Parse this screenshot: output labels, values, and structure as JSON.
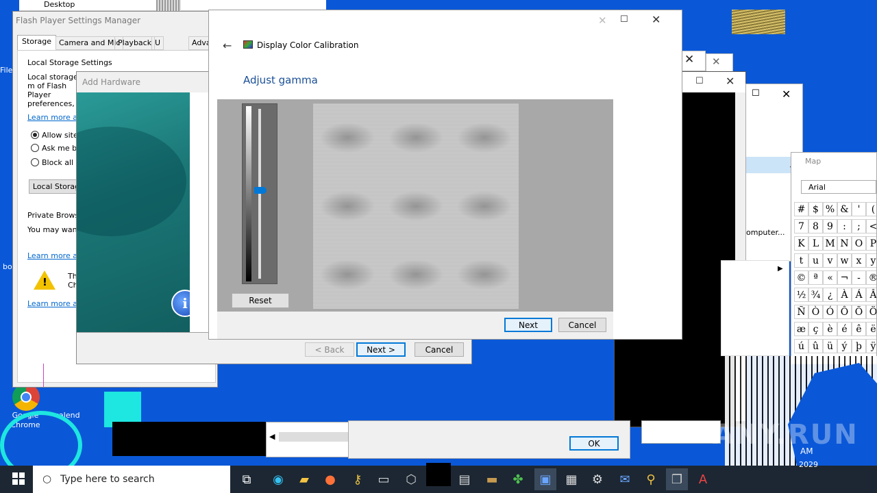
{
  "desktop": {
    "icons": [
      {
        "label": "Google Chrome"
      },
      {
        "label": "calend"
      },
      {
        "label": "bo"
      },
      {
        "label": "File"
      }
    ],
    "watermark": "ANY.RUN",
    "top_file_labels": [
      "Desktop"
    ]
  },
  "flash_window": {
    "title": "Flash Player Settings Manager",
    "tabs": [
      "Storage",
      "Camera and Mic",
      "Playback",
      "U",
      "Advance"
    ],
    "section_title": "Local Storage Settings",
    "description": "Local storage m of Flash Player preferences, o",
    "learn_more": "Learn more abo",
    "radios": [
      "Allow sites",
      "Ask me bef",
      "Block all sit"
    ],
    "local_storage_button": "Local Storag",
    "private_title": "Private Browsin",
    "private_text": "You may want",
    "learn_more_2": "Learn more abo",
    "warning_text": "Th Ch",
    "learn_more_3": "Learn more abo"
  },
  "add_hardware": {
    "title": "Add Hardware",
    "back_label": "< Back",
    "next_label": "Next >",
    "cancel_label": "Cancel"
  },
  "dcc": {
    "title": "Display Color Calibration",
    "heading": "Adjust gamma",
    "reset_label": "Reset",
    "next_label": "Next",
    "cancel_label": "Cancel",
    "slider_level": 0.52
  },
  "charmap": {
    "title": "Map",
    "font": "Arial",
    "side_text": "omputer...",
    "rows": [
      [
        "#",
        "$",
        "%",
        "&",
        "'",
        "("
      ],
      [
        "7",
        "8",
        "9",
        ":",
        ";",
        "<"
      ],
      [
        "K",
        "L",
        "M",
        "N",
        "O",
        "P"
      ],
      [
        "t",
        "u",
        "v",
        "w",
        "x",
        "y"
      ],
      [
        "©",
        "ª",
        "«",
        "¬",
        "-",
        "®"
      ],
      [
        "½",
        "¾",
        "¿",
        "À",
        "Á",
        "Â"
      ],
      [
        "Ñ",
        "Ò",
        "Ó",
        "Ô",
        "Õ",
        "Ö"
      ],
      [
        "æ",
        "ç",
        "è",
        "é",
        "ê",
        "ë"
      ],
      [
        "ú",
        "û",
        "ü",
        "ý",
        "þ",
        "ÿ"
      ]
    ]
  },
  "ok_dialog": {
    "ok_label": "OK"
  },
  "taskbar": {
    "search_placeholder": "Type here to search",
    "clock_time": "AM",
    "clock_date": "2029"
  },
  "colors": {
    "accent": "#0078d7",
    "desktop": "#0a58d8",
    "taskbar": "#1c2733",
    "heading": "#1a4f96"
  }
}
